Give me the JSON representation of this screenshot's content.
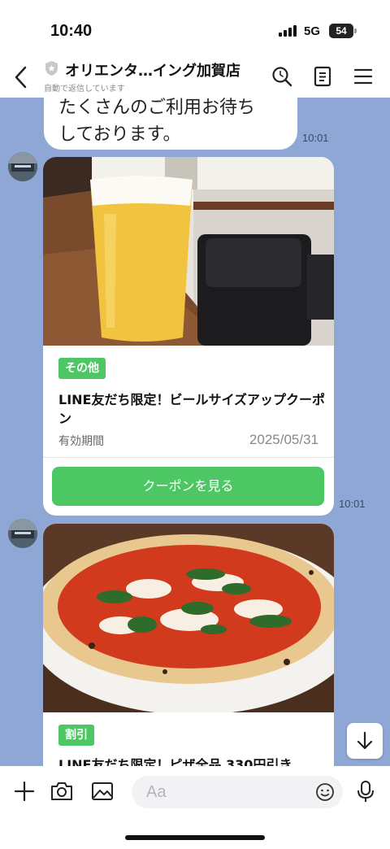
{
  "status": {
    "time": "10:40",
    "network": "5G",
    "battery": "54"
  },
  "header": {
    "title": "オリエンタ…イング加賀店",
    "subtitle": "自動で返信しています"
  },
  "messages": {
    "text_bubble": {
      "line1": "たくさんのご利用お待ち",
      "line2": "しております。",
      "time": "10:01"
    },
    "coupon1": {
      "badge": "その他",
      "title": "LINE友だち限定！ビールサイズアップクーポン",
      "validity_label": "有効期間",
      "validity_date": "2025/05/31",
      "button_label": "クーポンを見る",
      "time": "10:01"
    },
    "coupon2": {
      "badge": "割引",
      "title": "LINE友だち限定！ピザ全品 330円引き"
    }
  },
  "input": {
    "placeholder": "Aa"
  },
  "icons": {
    "back": "chevron-left-icon",
    "shield": "shield-icon",
    "search": "search-icon",
    "notes": "notes-icon",
    "menu": "menu-icon",
    "plus": "plus-icon",
    "camera": "camera-icon",
    "image": "image-icon",
    "emoji": "emoji-icon",
    "mic": "microphone-icon",
    "scroll": "arrow-down-icon"
  },
  "colors": {
    "chat_bg": "#8fa7d4",
    "accent_green": "#4cc764"
  }
}
